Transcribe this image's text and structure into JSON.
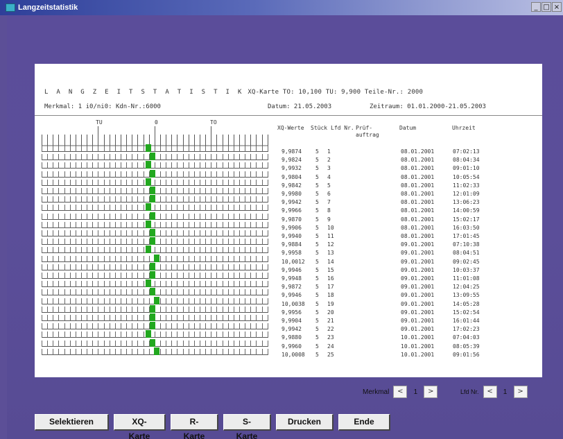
{
  "window": {
    "title": "Langzeitstatistik",
    "ctrl_min": "_",
    "ctrl_max": "□",
    "ctrl_close": "×"
  },
  "header": {
    "line1_spaced": "L A N G Z E I T S T A T I S T I K",
    "line1_rest": "XQ-Karte  TO: 10,100  TU:  9,900  Teile-Nr.: 2000",
    "line2_left": "Merkmal: 1   i0/ni0:   Kdn-Nr.:6000",
    "datum": "Datum: 21.05.2003",
    "zeitraum": "Zeitraum: 01.01.2000-21.05.2003"
  },
  "scale": {
    "tu": "TU",
    "zero": "0",
    "to": "TO"
  },
  "table": {
    "headers": {
      "xq": "XQ-Werte",
      "stueck": "Stück",
      "lfd": "Lfd Nr.",
      "pruef": "Prüf-\nauftrag",
      "datum": "Datum",
      "uhrzeit": "Uhrzeit"
    },
    "rows": [
      {
        "xq": "9,9874",
        "stueck": "5",
        "lfd": "1",
        "datum": "08.01.2001",
        "uhrzeit": "07:02:13",
        "pos": 0
      },
      {
        "xq": "9,9824",
        "stueck": "5",
        "lfd": "2",
        "datum": "08.01.2001",
        "uhrzeit": "08:04:34",
        "pos": 1
      },
      {
        "xq": "9,9932",
        "stueck": "5",
        "lfd": "3",
        "datum": "08.01.2001",
        "uhrzeit": "09:01:10",
        "pos": 0
      },
      {
        "xq": "9,9804",
        "stueck": "5",
        "lfd": "4",
        "datum": "08.01.2001",
        "uhrzeit": "10:05:54",
        "pos": 1
      },
      {
        "xq": "9,9842",
        "stueck": "5",
        "lfd": "5",
        "datum": "08.01.2001",
        "uhrzeit": "11:02:33",
        "pos": 0
      },
      {
        "xq": "9,9980",
        "stueck": "5",
        "lfd": "6",
        "datum": "08.01.2001",
        "uhrzeit": "12:01:09",
        "pos": 1
      },
      {
        "xq": "9,9942",
        "stueck": "5",
        "lfd": "7",
        "datum": "08.01.2001",
        "uhrzeit": "13:06:23",
        "pos": 1
      },
      {
        "xq": "9,9966",
        "stueck": "5",
        "lfd": "8",
        "datum": "08.01.2001",
        "uhrzeit": "14:00:59",
        "pos": 0
      },
      {
        "xq": "9,9870",
        "stueck": "5",
        "lfd": "9",
        "datum": "08.01.2001",
        "uhrzeit": "15:02:17",
        "pos": 1
      },
      {
        "xq": "9,9906",
        "stueck": "5",
        "lfd": "10",
        "datum": "08.01.2001",
        "uhrzeit": "16:03:50",
        "pos": 0
      },
      {
        "xq": "9,9940",
        "stueck": "5",
        "lfd": "11",
        "datum": "08.01.2001",
        "uhrzeit": "17:01:45",
        "pos": 1
      },
      {
        "xq": "9,9884",
        "stueck": "5",
        "lfd": "12",
        "datum": "09.01.2001",
        "uhrzeit": "07:10:38",
        "pos": 1
      },
      {
        "xq": "9,9958",
        "stueck": "5",
        "lfd": "13",
        "datum": "09.01.2001",
        "uhrzeit": "08:04:51",
        "pos": 0
      },
      {
        "xq": "10,0012",
        "stueck": "5",
        "lfd": "14",
        "datum": "09.01.2001",
        "uhrzeit": "09:02:45",
        "pos": 2
      },
      {
        "xq": "9,9946",
        "stueck": "5",
        "lfd": "15",
        "datum": "09.01.2001",
        "uhrzeit": "10:03:37",
        "pos": 1
      },
      {
        "xq": "9,9948",
        "stueck": "5",
        "lfd": "16",
        "datum": "09.01.2001",
        "uhrzeit": "11:01:08",
        "pos": 1
      },
      {
        "xq": "9,9872",
        "stueck": "5",
        "lfd": "17",
        "datum": "09.01.2001",
        "uhrzeit": "12:04:25",
        "pos": 0
      },
      {
        "xq": "9,9946",
        "stueck": "5",
        "lfd": "18",
        "datum": "09.01.2001",
        "uhrzeit": "13:09:55",
        "pos": 1
      },
      {
        "xq": "10,0038",
        "stueck": "5",
        "lfd": "19",
        "datum": "09.01.2001",
        "uhrzeit": "14:05:28",
        "pos": 2
      },
      {
        "xq": "9,9956",
        "stueck": "5",
        "lfd": "20",
        "datum": "09.01.2001",
        "uhrzeit": "15:02:54",
        "pos": 1
      },
      {
        "xq": "9,9904",
        "stueck": "5",
        "lfd": "21",
        "datum": "09.01.2001",
        "uhrzeit": "16:01:44",
        "pos": 1
      },
      {
        "xq": "9,9942",
        "stueck": "5",
        "lfd": "22",
        "datum": "09.01.2001",
        "uhrzeit": "17:02:23",
        "pos": 1
      },
      {
        "xq": "9,9880",
        "stueck": "5",
        "lfd": "23",
        "datum": "10.01.2001",
        "uhrzeit": "07:04:03",
        "pos": 0
      },
      {
        "xq": "9,9960",
        "stueck": "5",
        "lfd": "24",
        "datum": "10.01.2001",
        "uhrzeit": "08:05:39",
        "pos": 1
      },
      {
        "xq": "10,0008",
        "stueck": "5",
        "lfd": "25",
        "datum": "10.01.2001",
        "uhrzeit": "09:01:56",
        "pos": 2
      }
    ]
  },
  "colors": {
    "marker": "#22a81f",
    "background": "#5c4f97"
  },
  "nav": {
    "merkmal_label": "Merkmal",
    "merkmal_value": "1",
    "lfd_label": "Lfd Nr.",
    "lfd_value": "1",
    "prev": "<",
    "next": ">"
  },
  "buttons": {
    "selektieren": "Selektieren",
    "xq_karte": "XQ-Karte",
    "r_karte": "R-Karte",
    "s_karte": "S-Karte",
    "drucken": "Drucken",
    "ende": "Ende"
  }
}
